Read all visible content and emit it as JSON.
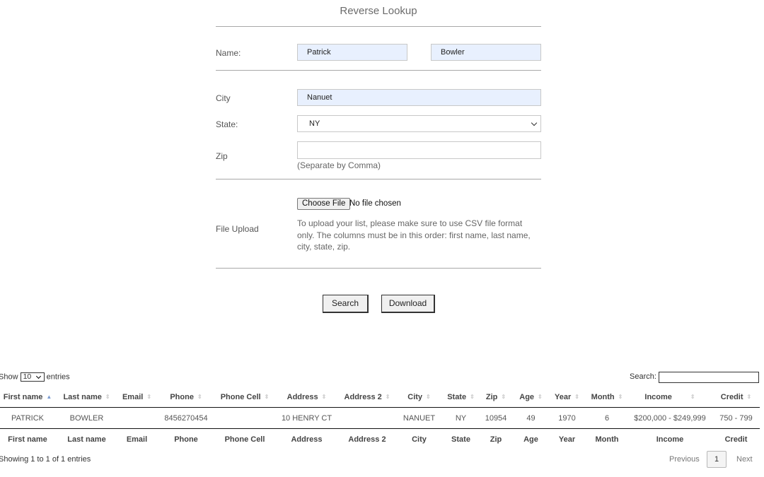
{
  "form": {
    "title": "Reverse Lookup",
    "name_label": "Name:",
    "first_name_value": "Patrick",
    "last_name_value": "Bowler",
    "city_label": "City",
    "city_value": "Nanuet",
    "state_label": "State:",
    "state_value": "NY",
    "zip_label": "Zip",
    "zip_value": "",
    "zip_hint": "(Separate by Comma)",
    "file_label": "File Upload",
    "choose_file_label": "Choose File",
    "no_file_text": "No file chosen",
    "upload_help": "To upload your list, please make sure to use CSV file format only. The columns must be in this order: first name, last name, city, state, zip.",
    "search_button": "Search",
    "download_button": "Download"
  },
  "table": {
    "show_label": "Show",
    "entries_label": "entries",
    "page_length": "10",
    "search_label": "Search:",
    "columns": [
      "First name",
      "Last name",
      "Email",
      "Phone",
      "Phone Cell",
      "Address",
      "Address 2",
      "City",
      "State",
      "Zip",
      "Age",
      "Year",
      "Month",
      "Income",
      "Credit"
    ],
    "sorted_column": "First name",
    "sort_direction": "ascending",
    "rows": [
      [
        "PATRICK",
        "BOWLER",
        "",
        "8456270454",
        "",
        "10 HENRY CT",
        "",
        "NANUET",
        "NY",
        "10954",
        "49",
        "1970",
        "6",
        "$200,000 - $249,999",
        "750 - 799"
      ]
    ],
    "info": "Showing 1 to 1 of 1 entries",
    "pagination": {
      "previous": "Previous",
      "current_page": "1",
      "next": "Next"
    }
  }
}
